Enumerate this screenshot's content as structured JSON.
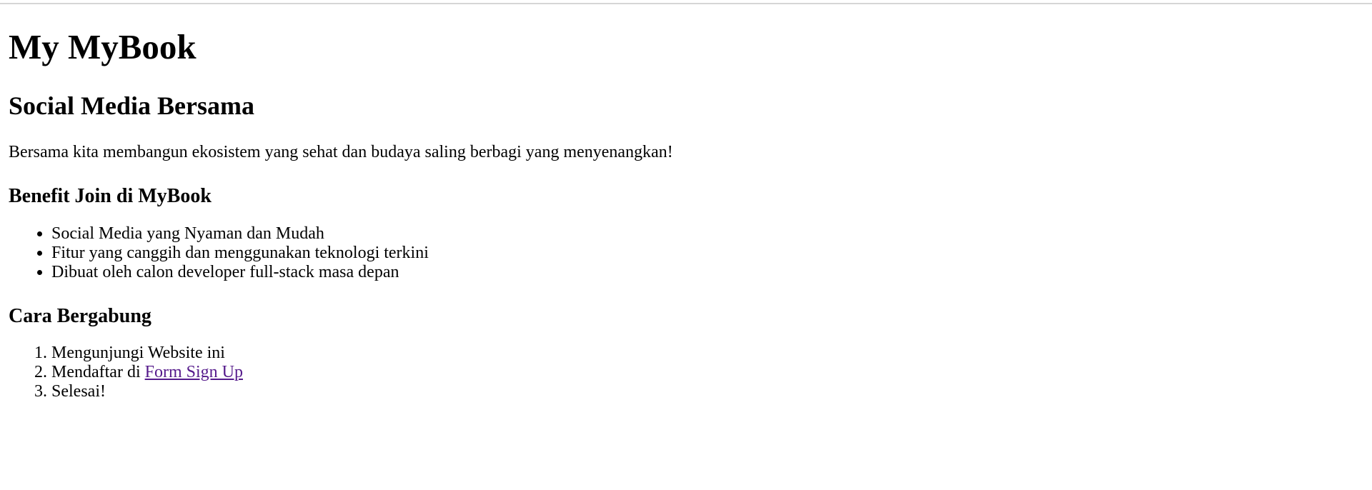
{
  "page": {
    "title": "My MyBook",
    "subtitle": "Social Media Bersama",
    "intro": "Bersama kita membangun ekosistem yang sehat dan budaya saling berbagi yang menyenangkan!"
  },
  "benefits": {
    "heading": "Benefit Join di MyBook",
    "items": [
      "Social Media yang Nyaman dan Mudah",
      "Fitur yang canggih dan menggunakan teknologi terkini",
      "Dibuat oleh calon developer full-stack masa depan"
    ]
  },
  "join": {
    "heading": "Cara Bergabung",
    "step1": "Mengunjungi Website ini",
    "step2_prefix": "Mendaftar di ",
    "step2_link": "Form Sign Up",
    "step3": "Selesai!"
  },
  "colors": {
    "visited_link": "#551a8b",
    "text": "#000000",
    "background": "#ffffff"
  }
}
